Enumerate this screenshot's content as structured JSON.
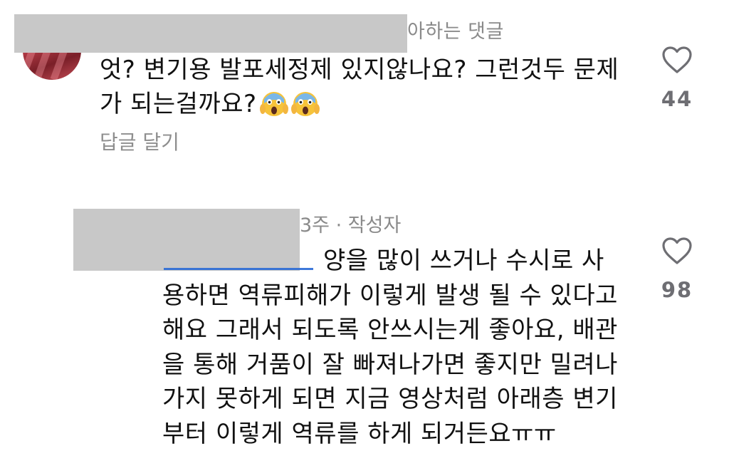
{
  "comments": [
    {
      "meta": "아하는 댓글",
      "text": "엇?  변기용 발포세정제 있지않나요? 그런것두 문제가 되는걸까요?",
      "emojis": [
        "scream-emoji",
        "scream-emoji"
      ],
      "reply_label": "답글 달기",
      "like_count": "44"
    },
    {
      "meta": "3주 · 작성자",
      "text": "양을 많이 쓰거나 수시로 사용하면 역류피해가 이렇게 발생 될 수 있다고 해요 그래서 되도록 안쓰시는게 좋아요, 배관을 통해 거품이 잘 빠져나가면 좋지만 밀려나가지 못하게 되면 지금 영상처럼 아래층 변기부터 이렇게 역류를 하게 되거든요ㅠㅠ",
      "like_count": "98"
    }
  ],
  "icons": {
    "like": "heart-outline-icon"
  },
  "colors": {
    "text": "#111111",
    "meta": "#8a8a8a",
    "reply": "#8e8e8e",
    "like_count": "#6e6e73",
    "redaction": "#c8c8c8",
    "mention": "#2a6ad6"
  }
}
